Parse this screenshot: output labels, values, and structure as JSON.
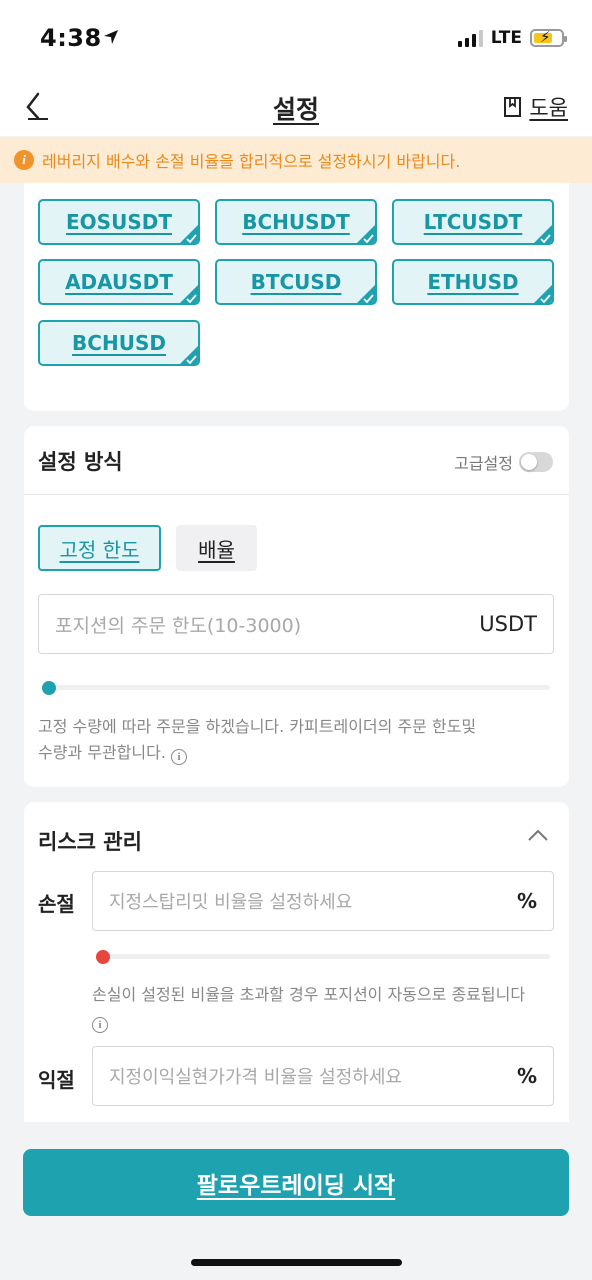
{
  "status": {
    "time": "4:38",
    "network": "LTE"
  },
  "nav": {
    "title": "설정",
    "help_label": "도움"
  },
  "warning": {
    "icon_glyph": "i",
    "text": "레버리지 배수와 손절 비율을 합리적으로 설정하시기 바랍니다."
  },
  "pairs": [
    "EOSUSDT",
    "BCHUSDT",
    "LTCUSDT",
    "ADAUSDT",
    "BTCUSD",
    "ETHUSD",
    "BCHUSD"
  ],
  "mode": {
    "heading": "설정 방식",
    "advanced_label": "고급설정",
    "advanced_on": false,
    "options": [
      "고정 한도",
      "배율"
    ],
    "selected": "고정 한도",
    "amount_placeholder": "포지션의 주문 한도(10-3000)",
    "amount_unit": "USDT",
    "slider_value": 0,
    "hint_line1": "고정 수량에 따라 주문을 하겠습니다. 카피트레이더의 주문 한도및",
    "hint_line2": "수량과 무관합니다.",
    "info_glyph": "i"
  },
  "risk": {
    "heading": "리스크 관리",
    "stop_loss_label": "손절",
    "stop_loss_placeholder": "지정스탑리밋 비율을 설정하세요",
    "stop_loss_unit": "%",
    "stop_loss_slider_value": 0,
    "stop_loss_hint": "손실이 설정된 비율을 초과할 경우 포지션이 자동으로 종료됩니다",
    "take_profit_label": "익절",
    "take_profit_placeholder": "지정이익실현가가격 비율을 설정하세요",
    "take_profit_unit": "%",
    "info_glyph": "i"
  },
  "start_button_label": "팔로우트레이딩 시작",
  "colors": {
    "accent": "#1fa2b0",
    "warning_bg": "#fdebd3",
    "warning_text": "#e98a1e",
    "stop_loss_dot": "#e8453c"
  }
}
